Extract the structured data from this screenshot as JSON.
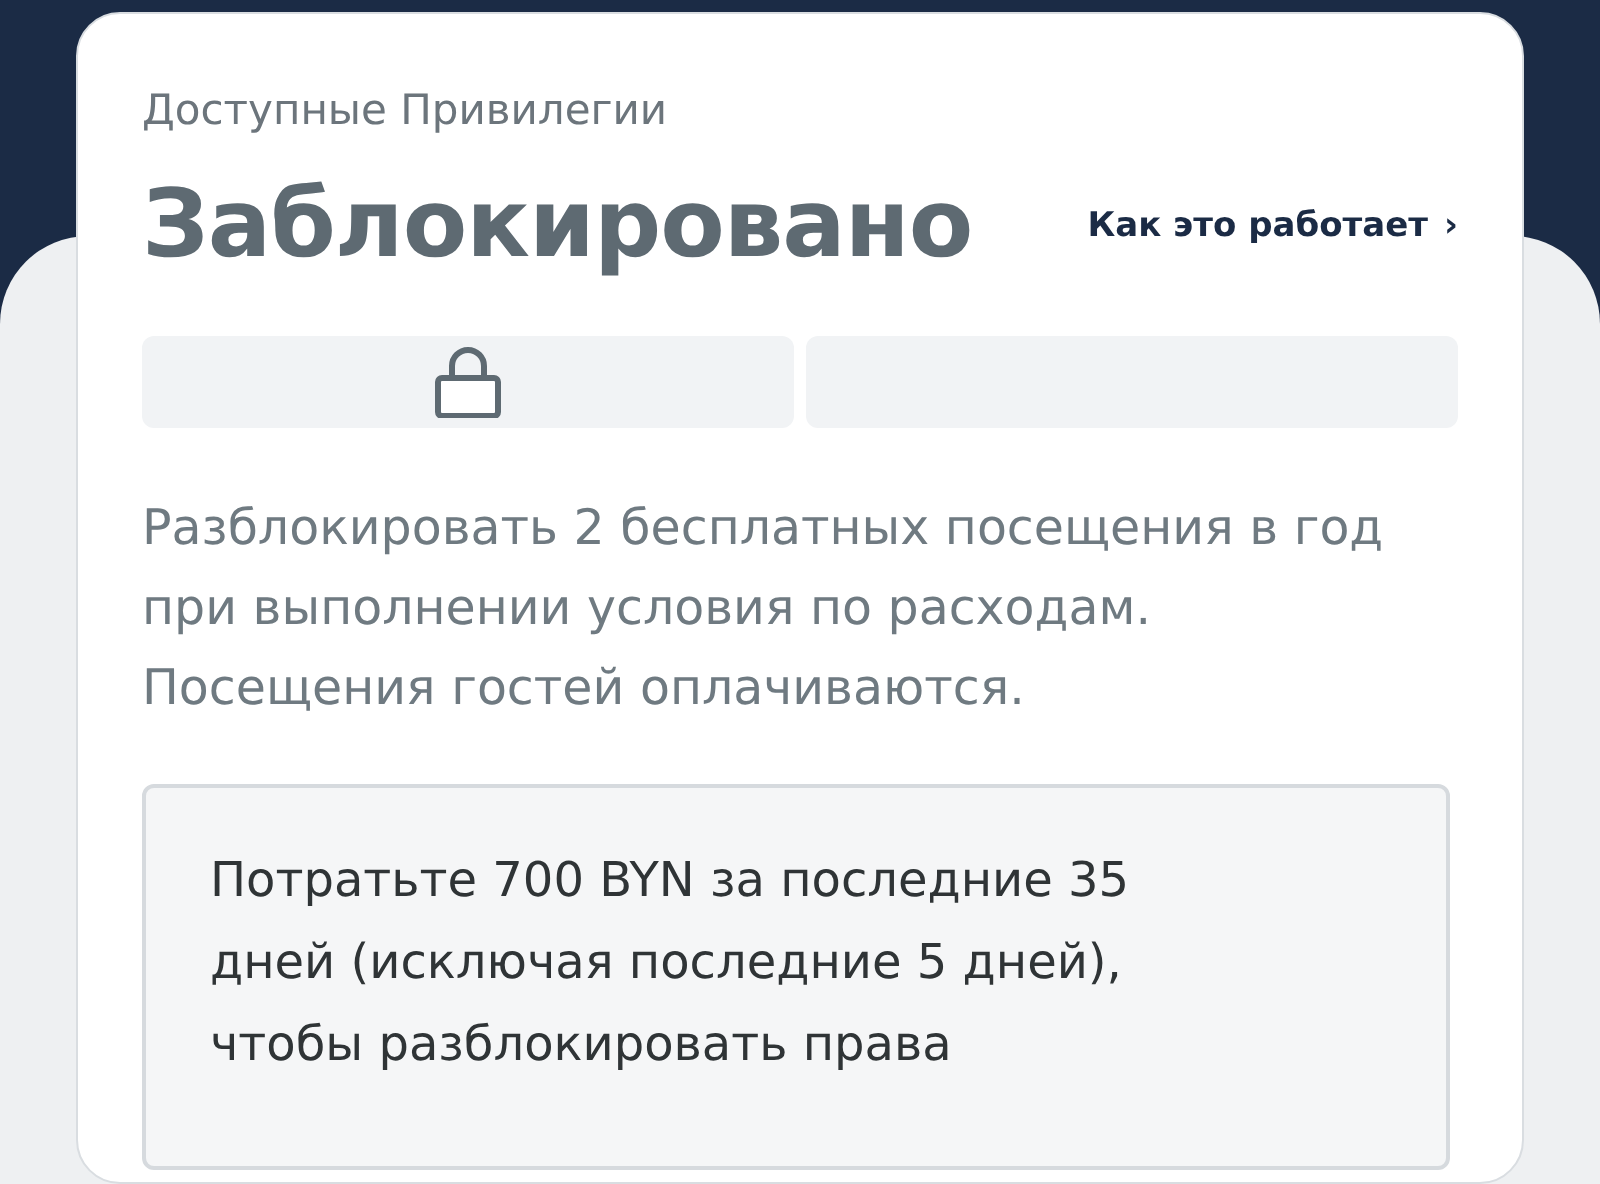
{
  "card": {
    "subtitle": "Доступные Привилегии",
    "status": "Заблокировано",
    "link": {
      "label": "Как это работает",
      "chevron": "›"
    },
    "segments": [
      {
        "locked": true
      },
      {
        "locked": false
      }
    ],
    "description": "Разблокировать 2 бесплатных посещения в год при выполнении условия по расходам. Посещения гостей оплачиваются.",
    "condition": "Потратьте 700 BYN за последние 35 дней (исключая последние 5 дней), чтобы разблокировать права"
  }
}
